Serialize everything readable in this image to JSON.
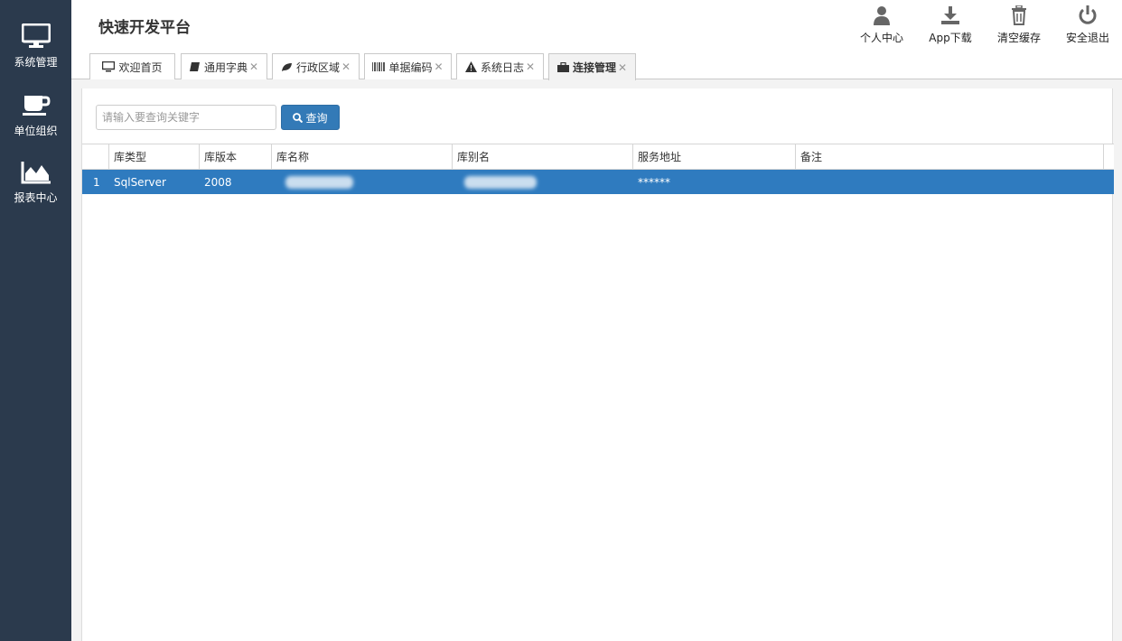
{
  "app": {
    "title": "快速开发平台"
  },
  "sidebar": {
    "items": [
      {
        "label": "系统管理",
        "icon": "monitor-icon"
      },
      {
        "label": "单位组织",
        "icon": "coffee-cup-icon"
      },
      {
        "label": "报表中心",
        "icon": "area-chart-icon"
      }
    ]
  },
  "header": {
    "actions": [
      {
        "label": "个人中心",
        "icon": "user-icon"
      },
      {
        "label": "App下载",
        "icon": "download-icon"
      },
      {
        "label": "清空缓存",
        "icon": "trash-icon"
      },
      {
        "label": "安全退出",
        "icon": "power-icon"
      }
    ]
  },
  "tabs": [
    {
      "label": "欢迎首页",
      "icon": "monitor-icon",
      "closable": false
    },
    {
      "label": "通用字典",
      "icon": "book-icon",
      "closable": true
    },
    {
      "label": "行政区域",
      "icon": "leaf-icon",
      "closable": true
    },
    {
      "label": "单据编码",
      "icon": "barcode-icon",
      "closable": true
    },
    {
      "label": "系统日志",
      "icon": "warning-icon",
      "closable": true
    },
    {
      "label": "连接管理",
      "icon": "briefcase-icon",
      "closable": true,
      "active": true
    }
  ],
  "search": {
    "placeholder": "请输入要查询关键字",
    "value": "",
    "button_label": "查询"
  },
  "table": {
    "columns": [
      "",
      "库类型",
      "库版本",
      "库名称",
      "库别名",
      "服务地址",
      "备注"
    ],
    "rows": [
      {
        "index": "1",
        "type": "SqlServer",
        "version": "2008",
        "name": "",
        "alias": "",
        "address": "******",
        "note": "",
        "selected": true
      }
    ]
  },
  "colors": {
    "sidebar": "#2b3a4d",
    "selection": "#2f7bbf",
    "primary_button": "#337ab7"
  }
}
